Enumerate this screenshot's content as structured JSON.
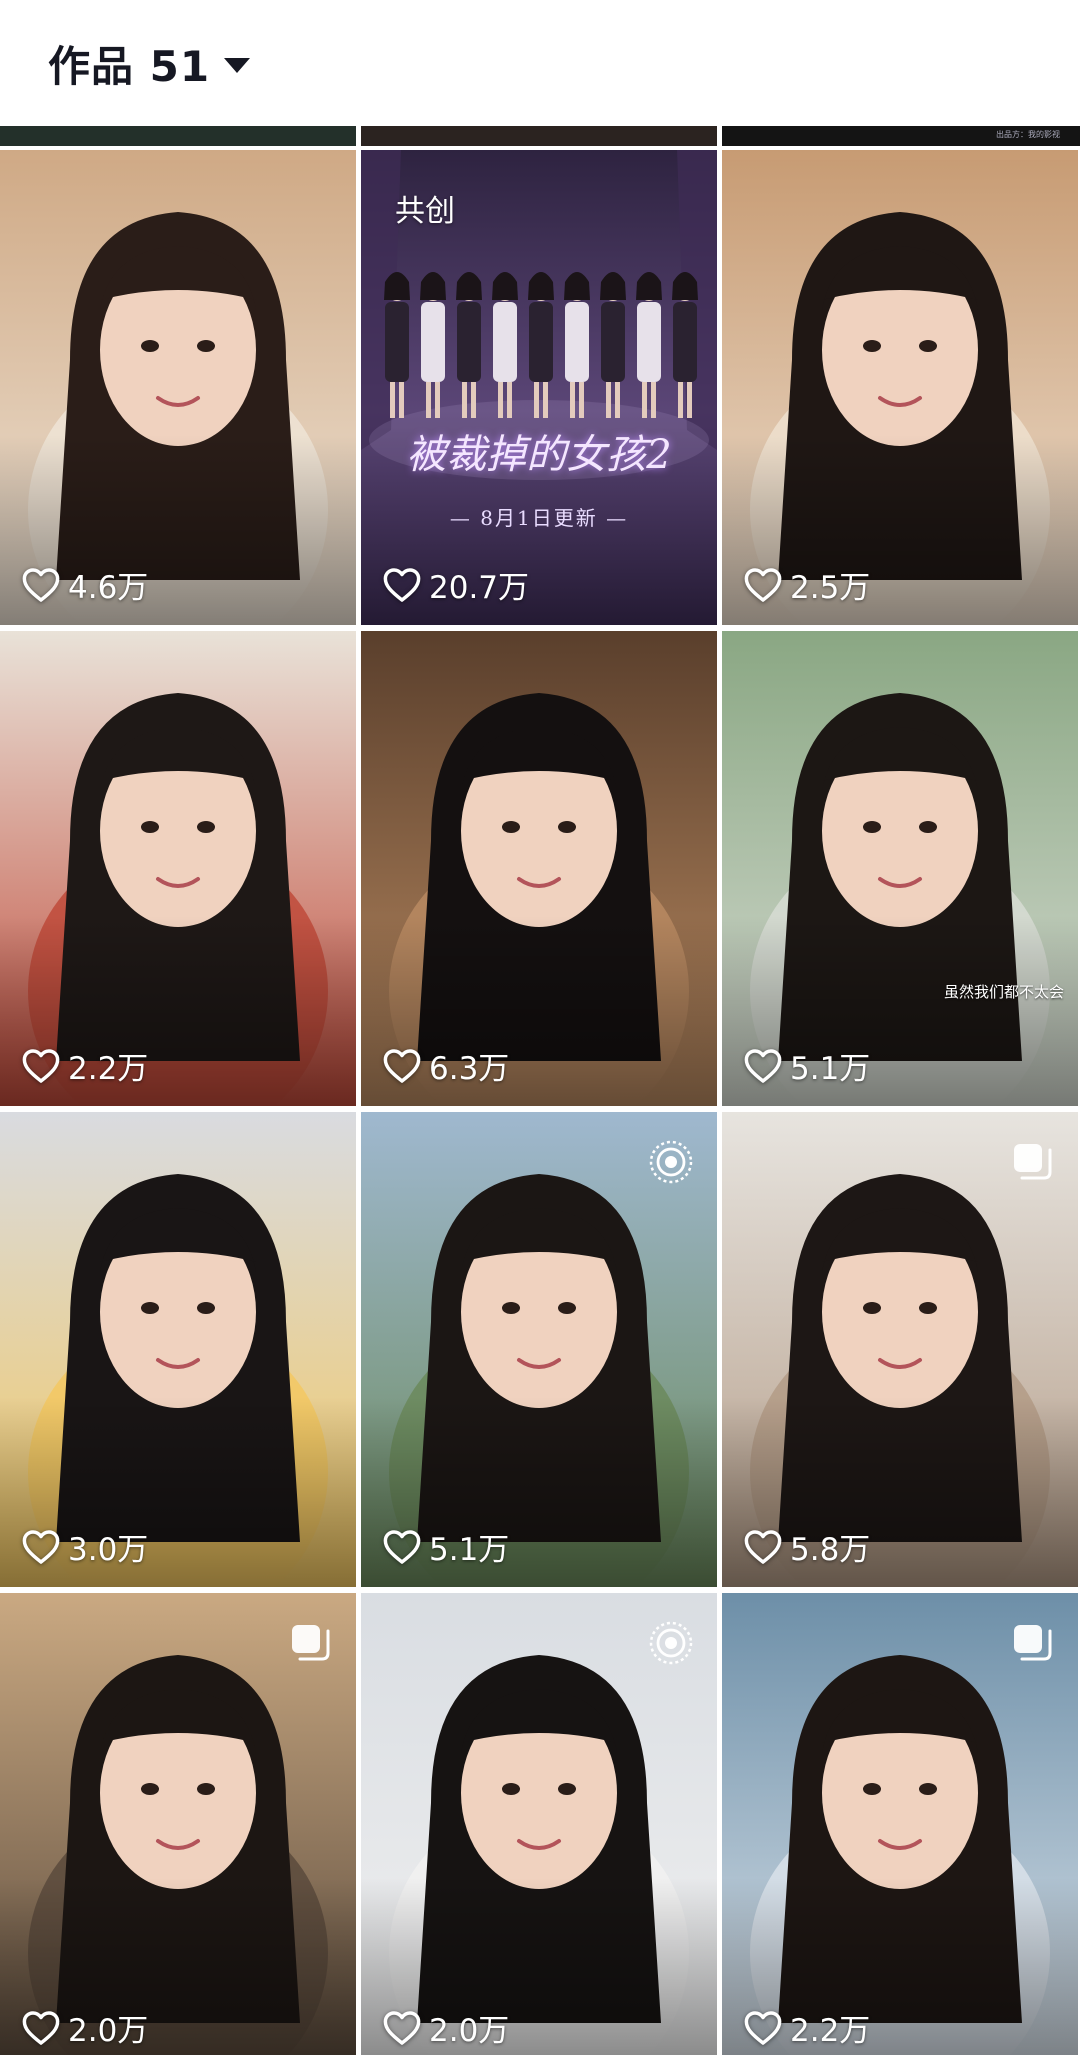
{
  "header": {
    "title": "作品 51"
  },
  "strip": {
    "right_text": "出品方：我的影视"
  },
  "tiles": [
    {
      "likes": "4.6万",
      "palette": [
        "#cfa985",
        "#efe4d6",
        "#2a1d18"
      ]
    },
    {
      "likes": "20.7万",
      "tag": "共创",
      "poster_title": "被裁掉的女孩2",
      "poster_sub": "— 8月1日更新 —",
      "palette": [
        "#2e2340",
        "#5b4677",
        "#c9b4e4"
      ]
    },
    {
      "likes": "2.5万",
      "palette": [
        "#c79b73",
        "#efe0cf",
        "#1f1714"
      ]
    },
    {
      "likes": "2.2万",
      "palette": [
        "#e9e2d8",
        "#c04a3a",
        "#1e1816"
      ]
    },
    {
      "likes": "6.3万",
      "palette": [
        "#5a3f2c",
        "#b98a61",
        "#141010"
      ]
    },
    {
      "likes": "5.1万",
      "caption": "虽然我们都不太会",
      "palette": [
        "#8aa783",
        "#d7dcd3",
        "#1c1714"
      ]
    },
    {
      "likes": "3.0万",
      "palette": [
        "#d9dbe0",
        "#f3c861",
        "#191515"
      ]
    },
    {
      "likes": "5.1万",
      "badge": "live",
      "palette": [
        "#9fb8cf",
        "#6b8a5c",
        "#1b1614"
      ]
    },
    {
      "likes": "5.8万",
      "badge": "multi",
      "palette": [
        "#e7e4df",
        "#b39b86",
        "#1d1715"
      ]
    },
    {
      "likes": "2.0万",
      "badge": "multi",
      "palette": [
        "#caa982",
        "#5a4a3c",
        "#1c1613"
      ]
    },
    {
      "likes": "2.0万",
      "badge": "live",
      "palette": [
        "#d9dde2",
        "#f1f1f1",
        "#161312"
      ]
    },
    {
      "likes": "2.2万",
      "badge": "multi",
      "palette": [
        "#6d8fa8",
        "#d9e2ea",
        "#1d1613"
      ]
    }
  ]
}
